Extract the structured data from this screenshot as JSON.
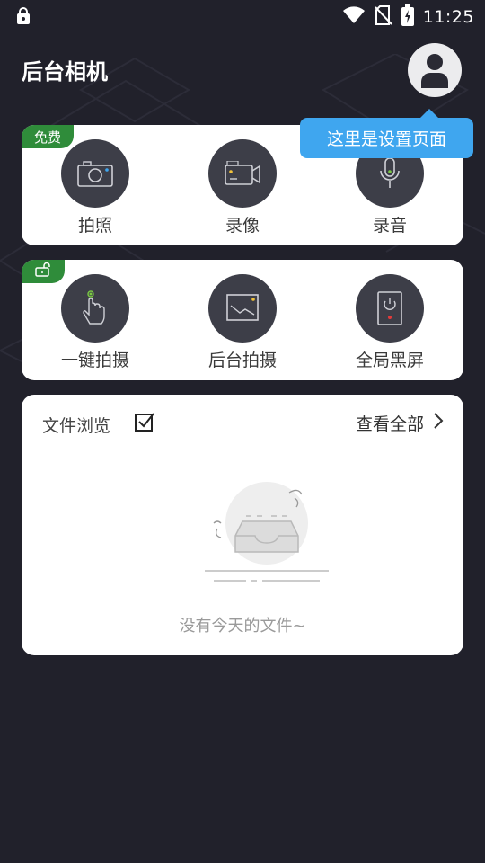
{
  "status_bar": {
    "time": "11:25",
    "icons": [
      "lock-badge-icon",
      "wifi-icon",
      "no-sim-icon",
      "battery-charging-icon"
    ]
  },
  "header": {
    "title": "后台相机",
    "avatar_icon": "user-avatar-icon"
  },
  "tooltip": {
    "text": "这里是设置页面"
  },
  "card_free": {
    "ribbon": "免费",
    "items": [
      {
        "label": "拍照",
        "icon": "camera-icon"
      },
      {
        "label": "录像",
        "icon": "video-camera-icon"
      },
      {
        "label": "录音",
        "icon": "microphone-icon"
      }
    ]
  },
  "card_locked": {
    "ribbon_icon": "unlock-icon",
    "items": [
      {
        "label": "一键拍摄",
        "icon": "tap-finger-icon"
      },
      {
        "label": "后台拍摄",
        "icon": "background-shot-icon"
      },
      {
        "label": "全局黑屏",
        "icon": "power-screen-icon"
      }
    ]
  },
  "files": {
    "title": "文件浏览",
    "view_all": "查看全部",
    "empty_text": "没有今天的文件~"
  },
  "colors": {
    "background": "#21212b",
    "card": "#ffffff",
    "ribbon": "#2f8c3a",
    "tooltip": "#3fa6ef",
    "icon_circle": "#3d3e48"
  }
}
